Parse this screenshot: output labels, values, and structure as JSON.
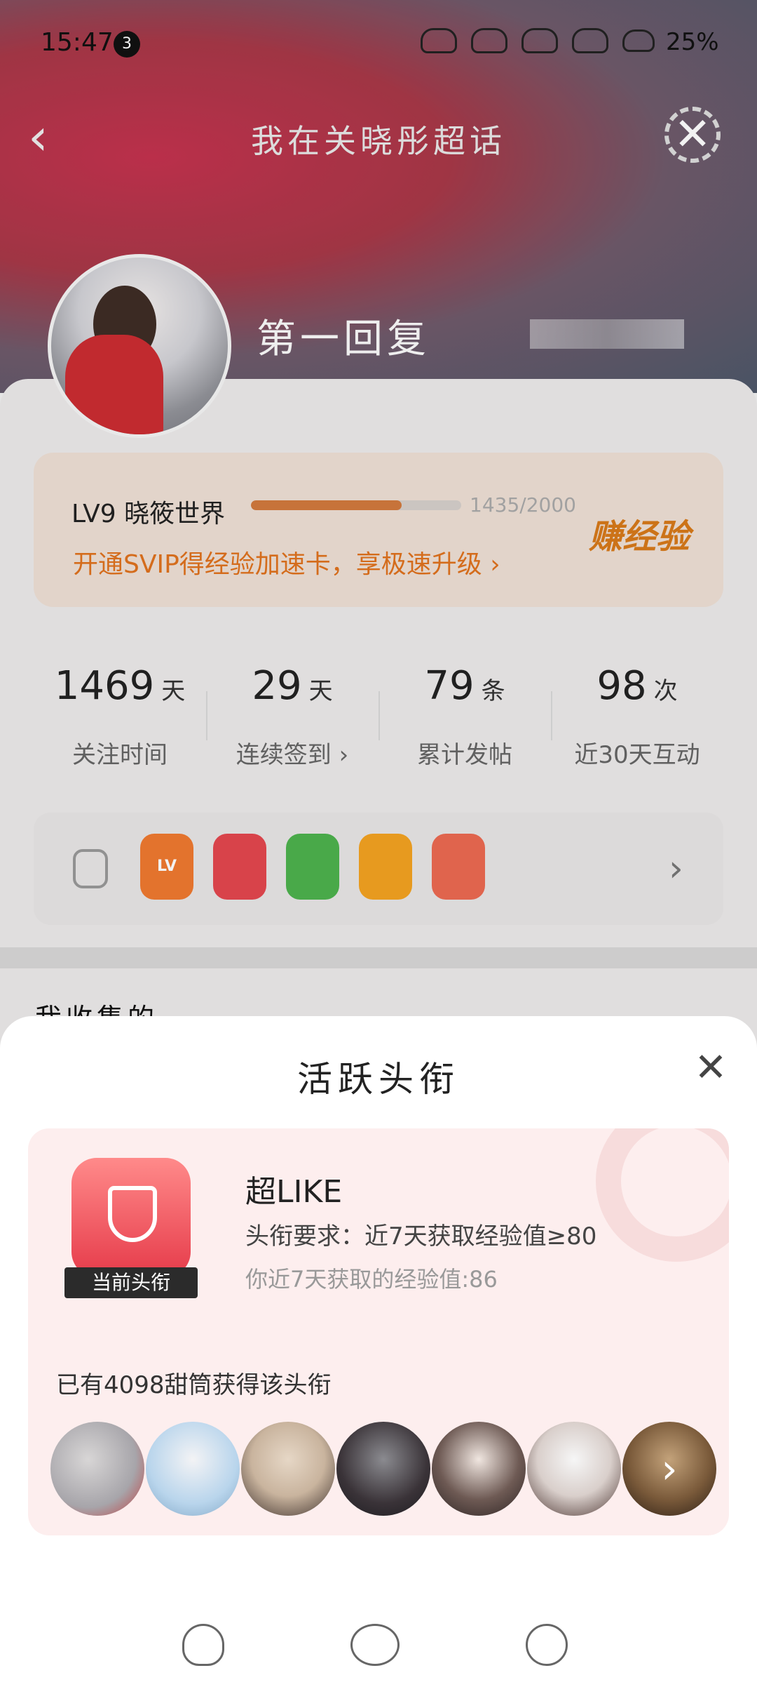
{
  "status_bar": {
    "time": "15:47",
    "notification_count": "3",
    "battery": "25%"
  },
  "nav": {
    "title": "我在关晓彤超话"
  },
  "profile": {
    "username": "第一回复"
  },
  "level": {
    "name": "LV9 晓筱世界",
    "progress_text": "1435/2000",
    "progress_fraction": 0.7175,
    "promo": "开通SVIP得经验加速卡，享极速升级 ›",
    "earn_label": "赚经验"
  },
  "stats": [
    {
      "value": "1469",
      "unit": "天",
      "label": "关注时间"
    },
    {
      "value": "29",
      "unit": "天",
      "label": "连续签到 ›"
    },
    {
      "value": "79",
      "unit": "条",
      "label": "累计发帖"
    },
    {
      "value": "98",
      "unit": "次",
      "label": "近30天互动"
    }
  ],
  "badges": [
    {
      "icon": "lv-badge-icon",
      "text": "LV",
      "color": "#f07a30"
    },
    {
      "icon": "trophy-badge-icon",
      "text": "",
      "color": "#e4474f"
    },
    {
      "icon": "hand-badge-icon",
      "text": "",
      "color": "#4db34d"
    },
    {
      "icon": "face-badge-icon",
      "text": "",
      "color": "#f4a321"
    },
    {
      "icon": "rock-hand-badge-icon",
      "text": "",
      "color": "#ec6a52"
    }
  ],
  "section": {
    "collected_title": "我收集的"
  },
  "sheet": {
    "title": "活跃头衔",
    "current_badge_tag": "当前头衔",
    "title_name": "超LIKE",
    "requirement": "头衔要求：近7天获取经验值≥80",
    "my_value": "你近7天获取的经验值:86",
    "holders_text": "已有4098甜筒获得该头衔",
    "avatar_count": 7
  }
}
